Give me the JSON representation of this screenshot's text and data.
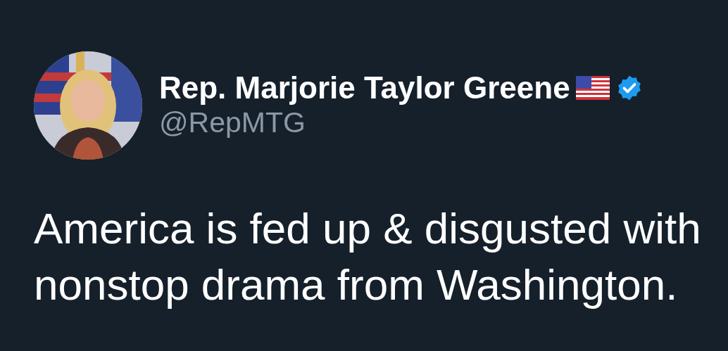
{
  "author": {
    "name": "Rep. Marjorie Taylor Greene",
    "handle": "@RepMTG",
    "verified": true
  },
  "tweet": {
    "text": "America is fed up & disgusted with nonstop drama from Washington."
  }
}
